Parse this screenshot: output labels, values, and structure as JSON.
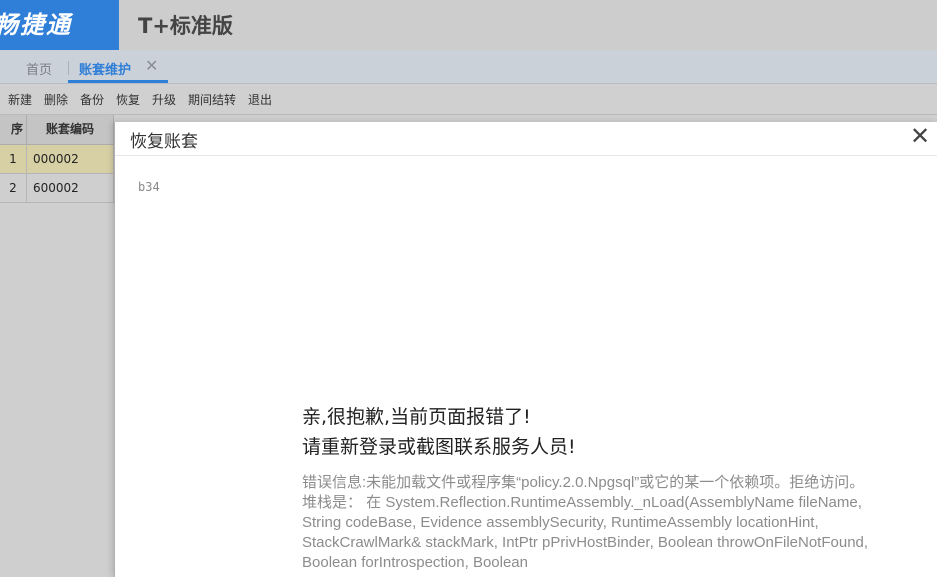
{
  "brand": {
    "product_name": "畅捷通",
    "edition": "T+标准版"
  },
  "tabs": [
    {
      "label": "首页"
    },
    {
      "label": "账套维护"
    }
  ],
  "toolbar": {
    "buttons": [
      "新建",
      "删除",
      "备份",
      "恢复",
      "升级",
      "期间结转",
      "退出"
    ]
  },
  "grid": {
    "headers": [
      "序号",
      "账套编码"
    ],
    "rows": [
      {
        "index": "1",
        "code": "000002"
      },
      {
        "index": "2",
        "code": "600002"
      }
    ]
  },
  "modal": {
    "title": "恢复账套",
    "debug_code": "b34",
    "error_line1": "亲,很抱歉,当前页面报错了!",
    "error_line2": "请重新登录或截图联系服务人员!",
    "error_detail": "错误信息:未能加载文件或程序集“policy.2.0.Npgsql”或它的某一个依赖项。拒绝访问。堆栈是： 在 System.Reflection.RuntimeAssembly._nLoad(AssemblyName fileName, String codeBase, Evidence assemblySecurity, RuntimeAssembly locationHint, StackCrawlMark& stackMark, IntPtr pPrivHostBinder, Boolean throwOnFileNotFound, Boolean forIntrospection, Boolean"
  },
  "colors": {
    "brand_blue": "#2f7ed8",
    "selected_row": "#d8d0a5"
  }
}
